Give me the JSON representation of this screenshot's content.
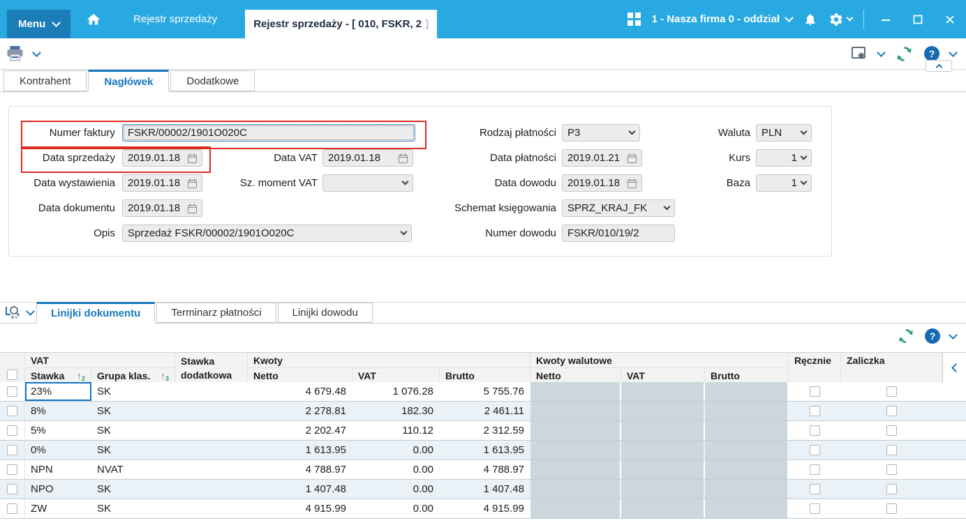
{
  "colors": {
    "topbar_blue": "#29a9e1",
    "menu_blue": "#1a7db8",
    "accent_blue": "#1779bd",
    "red_highlight": "#de2a1e",
    "disabled_cell": "#ccd6dd",
    "sort_green": "#2e9e68"
  },
  "topbar": {
    "menu_label": "Menu",
    "tab_inactive": "Rejestr sprzedaży",
    "tab_active": "Rejestr sprzedaży - [ 010, FSKR, 2",
    "tab_active_suffix": "]",
    "company": "1 - Nasza firma 0 - oddział"
  },
  "main_tabs": {
    "kontrahent": "Kontrahent",
    "naglowek": "Nagłówek",
    "dodatkowe": "Dodatkowe"
  },
  "form": {
    "numer_faktury": {
      "label": "Numer faktury",
      "value": "FSKR/00002/1901O020C"
    },
    "data_sprzedazy": {
      "label": "Data sprzedaży",
      "value": "2019.01.18"
    },
    "data_wystawienia": {
      "label": "Data wystawienia",
      "value": "2019.01.18"
    },
    "data_dokumentu": {
      "label": "Data dokumentu",
      "value": "2019.01.18"
    },
    "opis": {
      "label": "Opis",
      "value": "Sprzedaż FSKR/00002/1901O020C"
    },
    "data_vat": {
      "label": "Data VAT",
      "value": "2019.01.18"
    },
    "sz_moment_vat": {
      "label": "Sz. moment VAT",
      "value": ""
    },
    "rodzaj_platnosci": {
      "label": "Rodzaj płatności",
      "value": "P3"
    },
    "data_platnosci": {
      "label": "Data płatności",
      "value": "2019.01.21"
    },
    "data_dowodu": {
      "label": "Data dowodu",
      "value": "2019.01.18"
    },
    "schemat_ksiegowania": {
      "label": "Schemat księgowania",
      "value": "SPRZ_KRAJ_FK"
    },
    "numer_dowodu": {
      "label": "Numer dowodu",
      "value": "FSKR/010/19/2"
    },
    "waluta": {
      "label": "Waluta",
      "value": "PLN"
    },
    "kurs": {
      "label": "Kurs",
      "value": "1"
    },
    "baza": {
      "label": "Baza",
      "value": "1"
    }
  },
  "bottom_tabs": {
    "linijki_dokumentu": "Linijki dokumentu",
    "terminarz_platnosci": "Terminarz płatności",
    "linijki_dowodu": "Linijki dowodu"
  },
  "table": {
    "groups": {
      "vat": "VAT",
      "stawka_dod1": "Stawka",
      "stawka_dod2": "dodatkowa",
      "kwoty": "Kwoty",
      "kwoty_walutowe": "Kwoty walutowe",
      "recznie": "Ręcznie",
      "zaliczka": "Zaliczka"
    },
    "cols": {
      "stawka": "Stawka",
      "grupa": "Grupa klas.",
      "netto": "Netto",
      "vat": "VAT",
      "brutto": "Brutto",
      "w_netto": "Netto",
      "w_vat": "VAT",
      "w_brutto": "Brutto"
    },
    "sort": {
      "arrow": "↑",
      "stawka_n": "2",
      "grupa_n": "3"
    },
    "rows": [
      {
        "stawka": "23%",
        "grupa": "SK",
        "netto": "4 679.48",
        "vat": "1 076.28",
        "brutto": "5 755.76"
      },
      {
        "stawka": "8%",
        "grupa": "SK",
        "netto": "2 278.81",
        "vat": "182.30",
        "brutto": "2 461.11"
      },
      {
        "stawka": "5%",
        "grupa": "SK",
        "netto": "2 202.47",
        "vat": "110.12",
        "brutto": "2 312.59"
      },
      {
        "stawka": "0%",
        "grupa": "SK",
        "netto": "1 613.95",
        "vat": "0.00",
        "brutto": "1 613.95"
      },
      {
        "stawka": "NPN",
        "grupa": "NVAT",
        "netto": "4 788.97",
        "vat": "0.00",
        "brutto": "4 788.97"
      },
      {
        "stawka": "NPO",
        "grupa": "SK",
        "netto": "1 407.48",
        "vat": "0.00",
        "brutto": "1 407.48"
      },
      {
        "stawka": "ZW",
        "grupa": "SK",
        "netto": "4 915.99",
        "vat": "0.00",
        "brutto": "4 915.99"
      }
    ]
  },
  "icons": {
    "help_glyph": "?"
  }
}
